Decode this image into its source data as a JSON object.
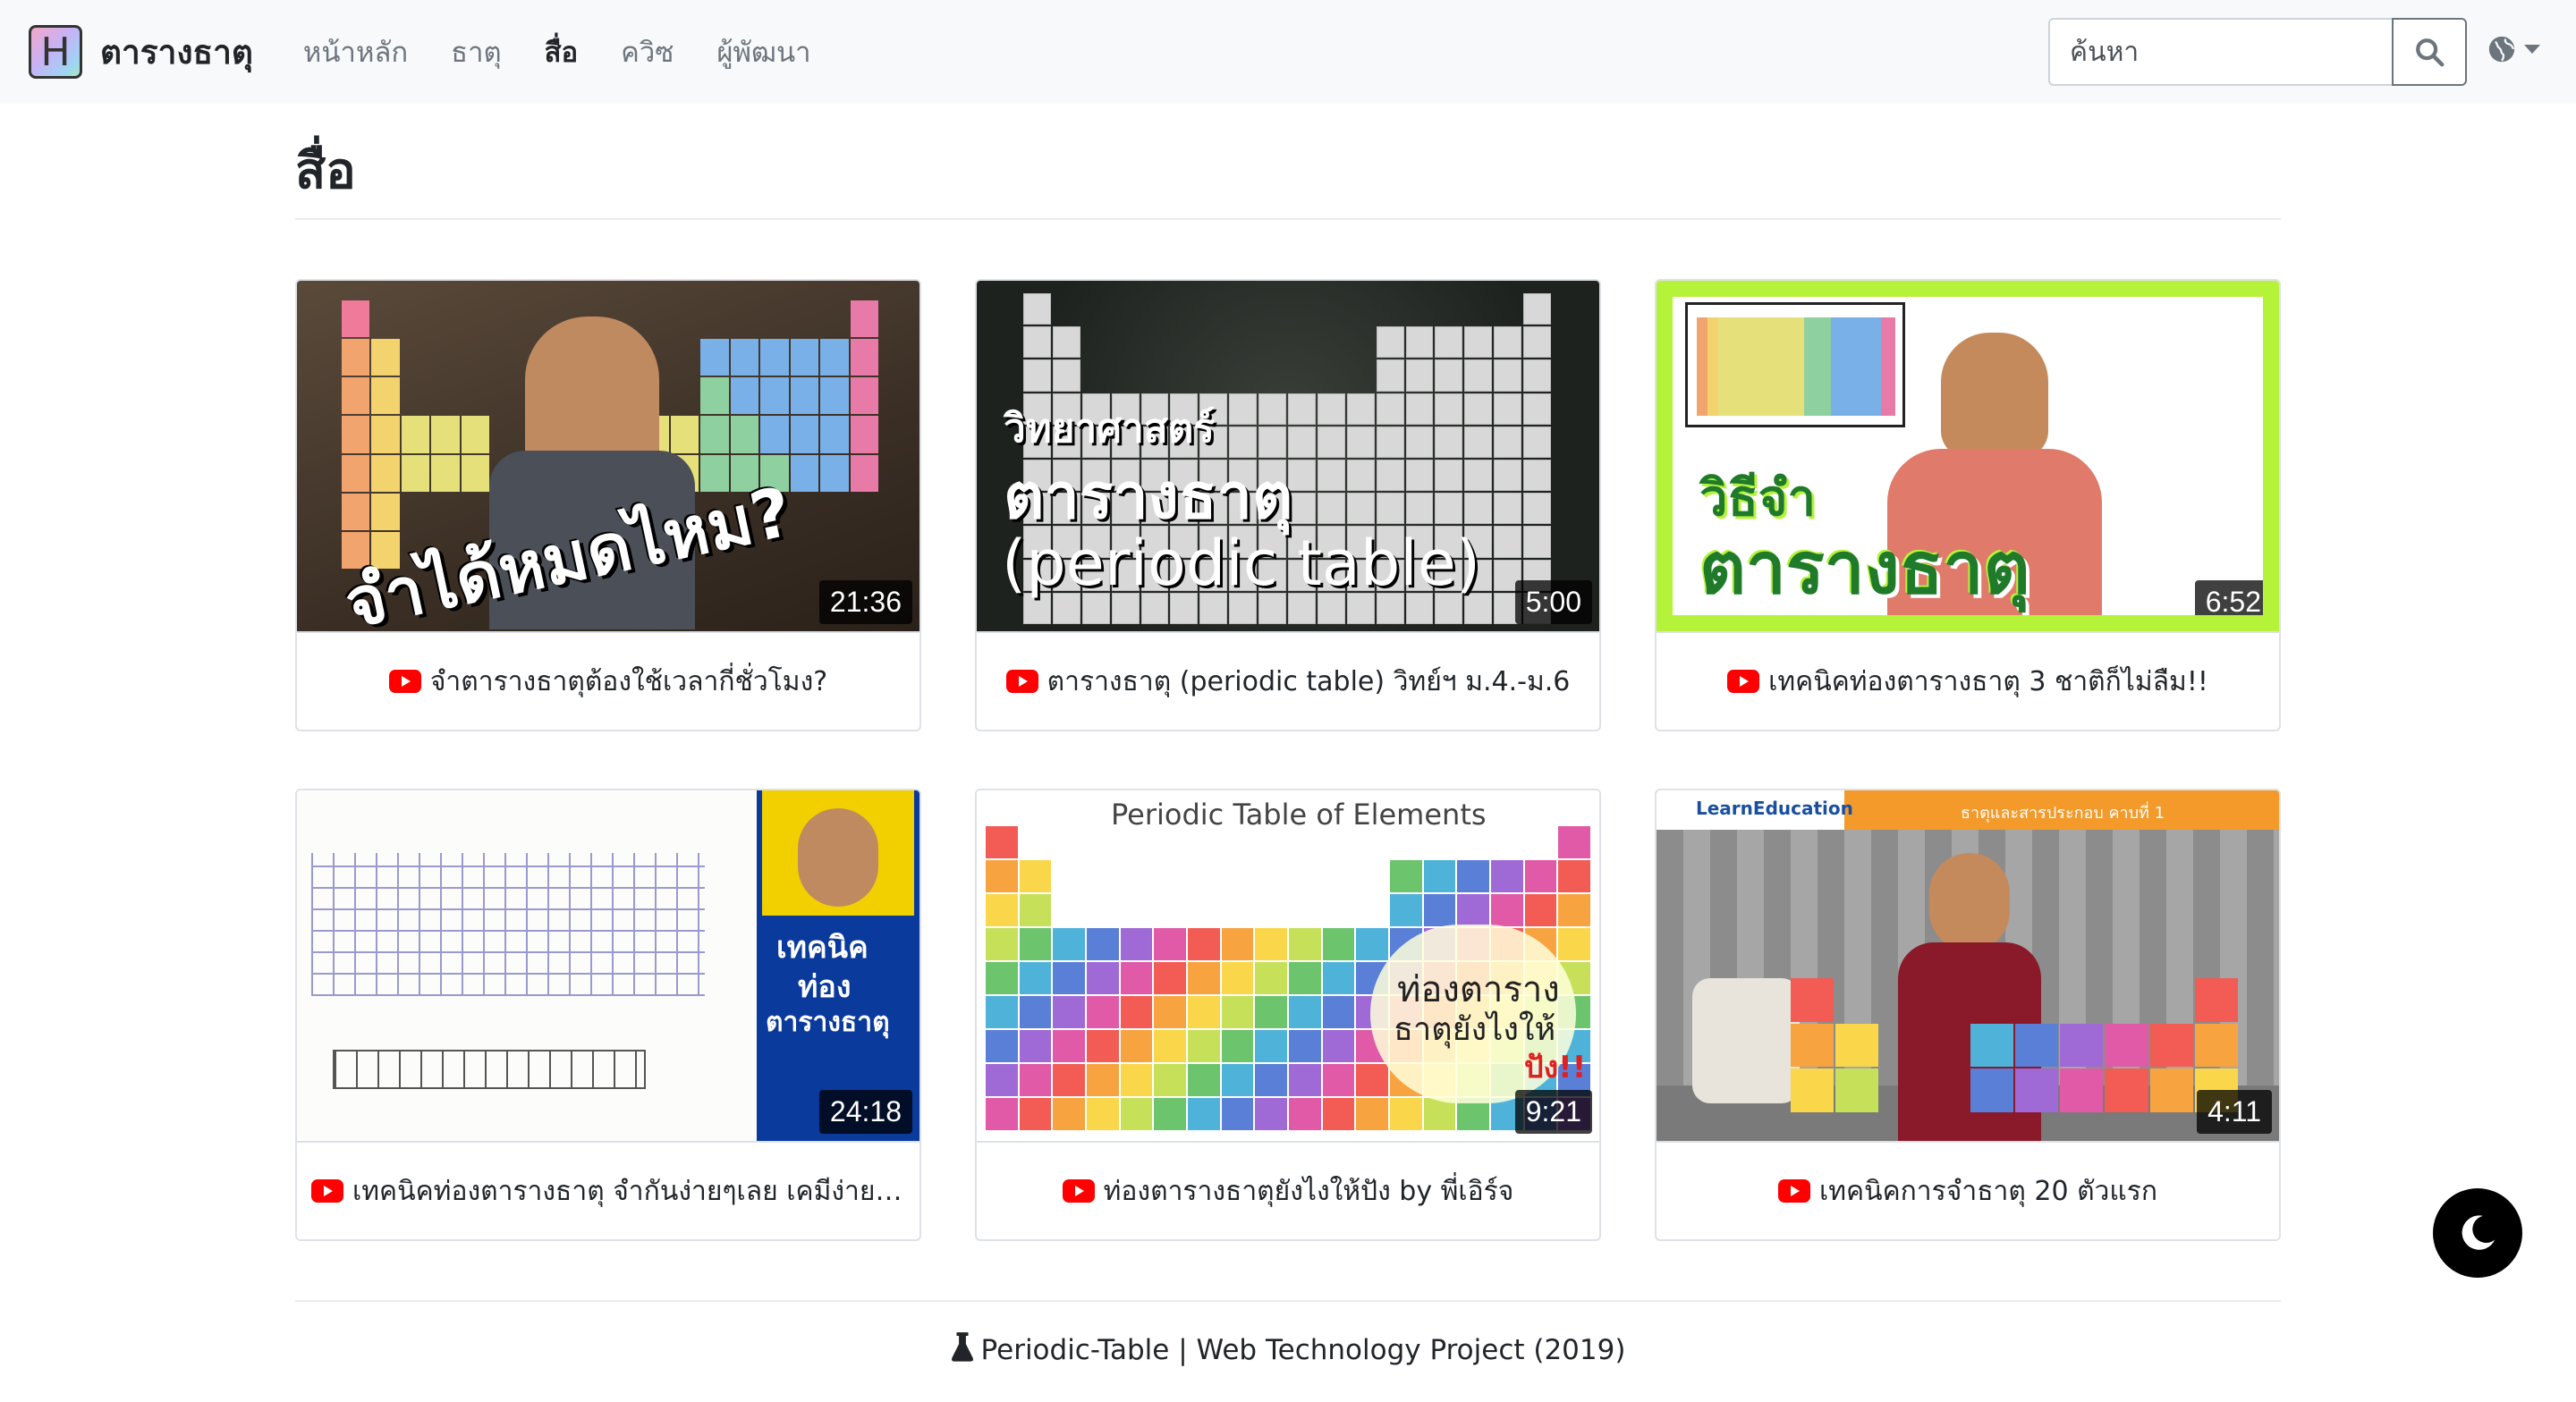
{
  "navbar": {
    "brand_letter": "H",
    "brand_name": "ตารางธาตุ",
    "links": [
      {
        "label": "หน้าหลัก",
        "active": false
      },
      {
        "label": "ธาตุ",
        "active": false
      },
      {
        "label": "สื่อ",
        "active": true
      },
      {
        "label": "ควิซ",
        "active": false
      },
      {
        "label": "ผู้พัฒนา",
        "active": false
      }
    ],
    "search_placeholder": "ค้นหา",
    "search_icon": "search-icon",
    "language_icon": "globe-icon"
  },
  "page": {
    "title": "สื่อ"
  },
  "videos": [
    {
      "title": "จำตารางธาตุต้องใช้เวลากี่ชั่วโมง?",
      "duration": "21:36",
      "thumb_text": "จำได้หมดไหม?"
    },
    {
      "title": "ตารางธาตุ (periodic table) วิทย์ฯ ม.4.-ม.6",
      "duration": "5:00",
      "thumb_text_1": "วิทยาศาสตร์",
      "thumb_text_2": "ตารางธาตุ",
      "thumb_text_3": "(periodic table)"
    },
    {
      "title": "เทคนิคท่องตารางธาตุ 3 ชาติก็ไม่ลืม!!",
      "duration": "6:52",
      "thumb_text_1": "วิธีจำ",
      "thumb_text_2": "ตารางธาตุ"
    },
    {
      "title": "เทคนิคท่องตารางธาตุ จำกันง่ายๆเลย เคมีง่ายนิดเดียว",
      "duration": "24:18",
      "thumb_text_1": "เทคนิค",
      "thumb_text_2": "ท่อง",
      "thumb_text_3": "ตารางธาตุ"
    },
    {
      "title": "ท่องตารางธาตุยังไงให้ปัง by พี่เอิร์จ",
      "duration": "9:21",
      "thumb_heading": "Periodic Table of Elements",
      "thumb_text_1": "ท่องตาราง",
      "thumb_text_2": "ธาตุยังไงให้",
      "thumb_text_3": "ปัง!!"
    },
    {
      "title": "เทคนิคการจำธาตุ 20 ตัวแรก",
      "duration": "4:11",
      "thumb_brand": "LearnEducation",
      "thumb_header": "ธาตุและสารประกอบ คาบที่ 1"
    }
  ],
  "footer": {
    "text": "Periodic-Table | Web Technology Project (2019)",
    "icon": "flask-icon"
  },
  "dark_mode_icon": "moon-icon",
  "colors": {
    "navbar_bg": "#f8f9fa",
    "youtube_red": "#ff0000",
    "lime_border": "#b5f23a",
    "toggle_bg": "#000000"
  }
}
